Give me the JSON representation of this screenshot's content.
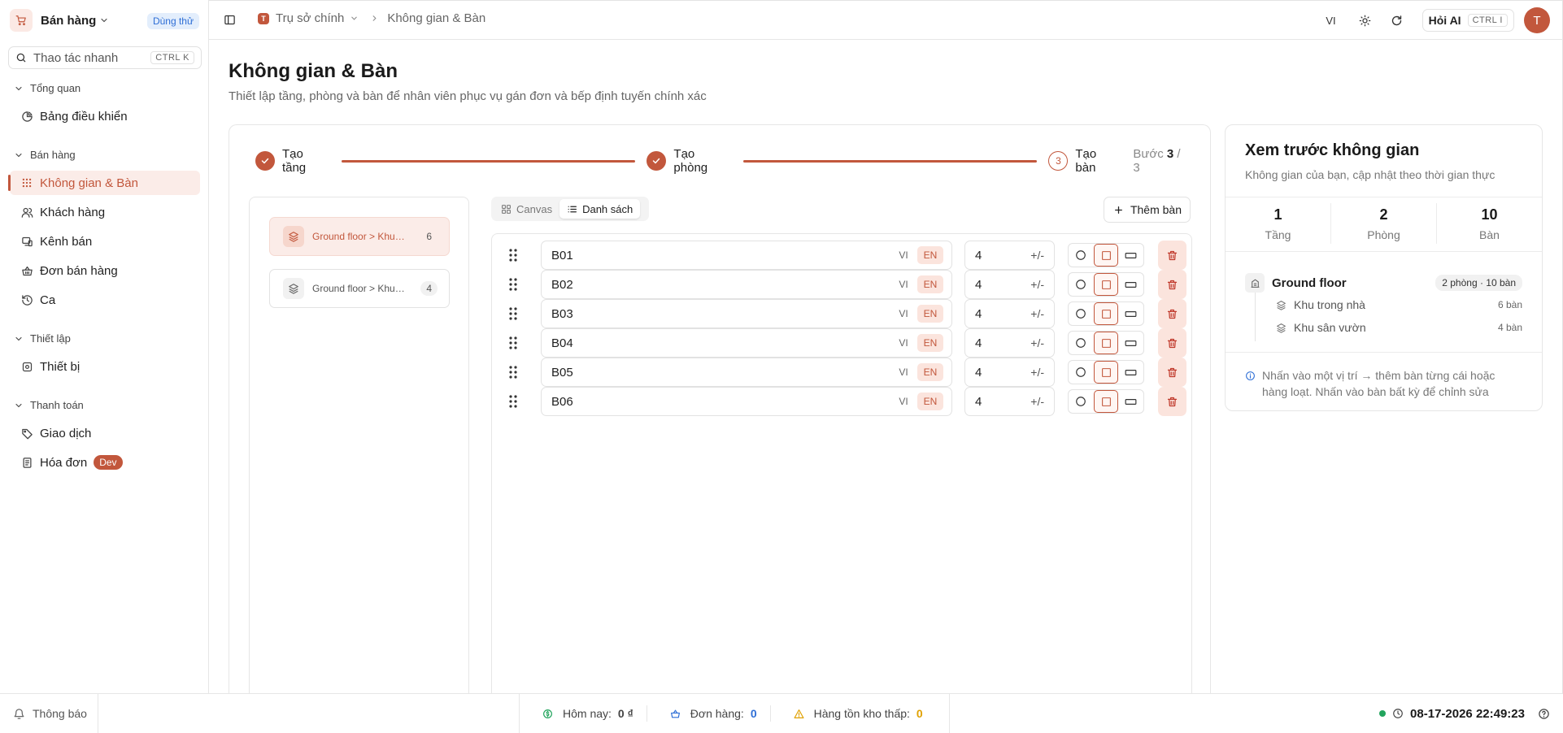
{
  "colors": {
    "accent": "#c2573c",
    "accent_soft": "#fbece8",
    "success": "#22a45d",
    "info": "#2f6fd6",
    "warning": "#e0a100"
  },
  "sidebar": {
    "brand": "Bán hàng",
    "trial_badge": "Dùng thử",
    "quick_action": {
      "placeholder": "Thao tác nhanh",
      "shortcut": "CTRL K"
    },
    "sections": [
      {
        "title": "Tổng quan",
        "items": [
          {
            "label": "Bảng điều khiển",
            "icon": "chart-pie-icon"
          }
        ]
      },
      {
        "title": "Bán hàng",
        "items": [
          {
            "label": "Không gian & Bàn",
            "icon": "grid-dots-icon",
            "active": true
          },
          {
            "label": "Khách hàng",
            "icon": "users-icon"
          },
          {
            "label": "Kênh bán",
            "icon": "channel-icon"
          },
          {
            "label": "Đơn bán hàng",
            "icon": "basket-icon"
          },
          {
            "label": "Ca",
            "icon": "history-icon"
          }
        ]
      },
      {
        "title": "Thiết lập",
        "items": [
          {
            "label": "Thiết bị",
            "icon": "device-icon"
          }
        ]
      },
      {
        "title": "Thanh toán",
        "items": [
          {
            "label": "Giao dịch",
            "icon": "tag-icon"
          },
          {
            "label": "Hóa đơn",
            "icon": "receipt-icon",
            "badge": "Dev"
          }
        ]
      }
    ]
  },
  "header": {
    "breadcrumb": {
      "branch_initial": "T",
      "branch": "Trụ sở chính",
      "current": "Không gian & Bàn"
    },
    "lang": "VI",
    "ask_ai": {
      "label": "Hỏi AI",
      "shortcut": "CTRL I"
    },
    "avatar_initial": "T"
  },
  "page": {
    "title": "Không gian & Bàn",
    "subtitle": "Thiết lập tầng, phòng và bàn để nhân viên phục vụ gán đơn và bếp định tuyến chính xác"
  },
  "wizard": {
    "steps": [
      {
        "label": "Tạo tầng",
        "done": true
      },
      {
        "label": "Tạo phòng",
        "done": true
      },
      {
        "label": "Tạo bàn",
        "number": "3",
        "done": false
      }
    ],
    "step_count": {
      "prefix": "Bước",
      "current": "3",
      "separator": "/",
      "total": "3"
    },
    "rooms": [
      {
        "name": "Ground floor > Khu trong nhà",
        "count": "6",
        "active": true
      },
      {
        "name": "Ground floor > Khu sân vườn",
        "count": "4",
        "active": false
      }
    ],
    "view_toggle": {
      "canvas": "Canvas",
      "list": "Danh sách",
      "selected": "list"
    },
    "add_table_label": "Thêm bàn",
    "tables": [
      {
        "name": "B01",
        "lang_vi": "VI",
        "lang_en": "EN",
        "seats": "4",
        "seats_control": "+/-",
        "shape": "square"
      },
      {
        "name": "B02",
        "lang_vi": "VI",
        "lang_en": "EN",
        "seats": "4",
        "seats_control": "+/-",
        "shape": "square"
      },
      {
        "name": "B03",
        "lang_vi": "VI",
        "lang_en": "EN",
        "seats": "4",
        "seats_control": "+/-",
        "shape": "square"
      },
      {
        "name": "B04",
        "lang_vi": "VI",
        "lang_en": "EN",
        "seats": "4",
        "seats_control": "+/-",
        "shape": "square"
      },
      {
        "name": "B05",
        "lang_vi": "VI",
        "lang_en": "EN",
        "seats": "4",
        "seats_control": "+/-",
        "shape": "square"
      },
      {
        "name": "B06",
        "lang_vi": "VI",
        "lang_en": "EN",
        "seats": "4",
        "seats_control": "+/-",
        "shape": "square"
      }
    ]
  },
  "preview": {
    "title": "Xem trước không gian",
    "subtitle": "Không gian của bạn, cập nhật theo thời gian thực",
    "stats": [
      {
        "value": "1",
        "label": "Tầng"
      },
      {
        "value": "2",
        "label": "Phòng"
      },
      {
        "value": "10",
        "label": "Bàn"
      }
    ],
    "floor": {
      "name": "Ground floor",
      "summary": "2 phòng · 10 bàn"
    },
    "zones": [
      {
        "name": "Khu trong nhà",
        "count": "6 bàn"
      },
      {
        "name": "Khu sân vườn",
        "count": "4 bàn"
      }
    ],
    "hint": "Nhấn vào một vị trí → thêm bàn từng cái hoặc hàng loạt. Nhấn vào bàn bất kỳ để chỉnh sửa"
  },
  "statusbar": {
    "notifications": "Thông báo",
    "today": {
      "label": "Hôm nay:",
      "value": "0 ₫"
    },
    "orders": {
      "label": "Đơn hàng:",
      "value": "0"
    },
    "low_stock": {
      "label": "Hàng tồn kho thấp:",
      "value": "0"
    },
    "datetime": "08-17-2026 22:49:23"
  }
}
